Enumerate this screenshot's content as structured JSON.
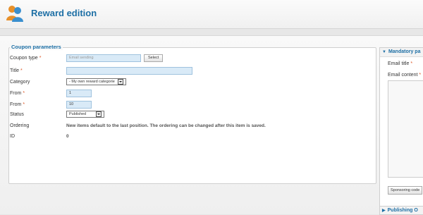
{
  "header": {
    "title": "Reward edition",
    "icon": "users-icon"
  },
  "coupon": {
    "legend": "Coupon parameters",
    "coupon_type_label": "Coupon type",
    "coupon_type_value": "Email sending",
    "select_button": "Select",
    "title_label": "Title",
    "title_value": "",
    "category_label": "Category",
    "category_value": "- My own reward categorie",
    "from1_label": "From",
    "from1_value": "1",
    "from2_label": "From",
    "from2_value": "10",
    "status_label": "Status",
    "status_value": "Published",
    "ordering_label": "Ordering",
    "ordering_text": "New items default to the last position. The ordering can be changed after this item is saved.",
    "id_label": "ID",
    "id_value": "0",
    "required_mark": "*"
  },
  "right_panel": {
    "header": "Mandatory pa",
    "email_title_label": "Email title",
    "email_content_label": "Email content",
    "sponsoring_button": "Sponsoring code",
    "publishing_header": "Publishing O"
  },
  "colors": {
    "accent": "#1d6fa5",
    "required": "#dd5522",
    "input_bg": "#d9eaf7"
  }
}
